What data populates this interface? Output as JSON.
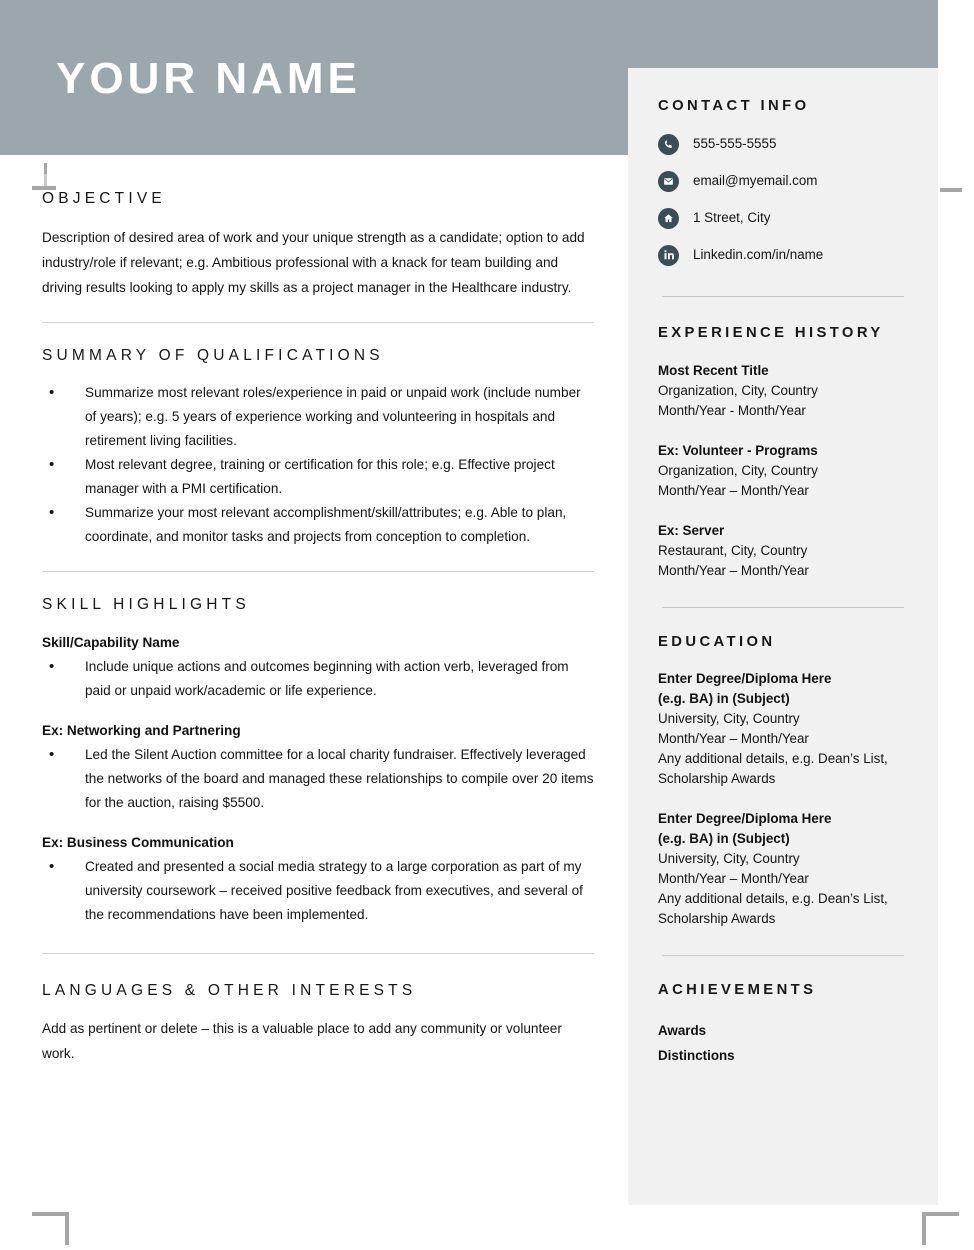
{
  "header": {
    "name": "YOUR NAME",
    "band_color": "#9ca7ad"
  },
  "sidebar": {
    "background": "#f1f1f1",
    "icon_color": "#3b4d57",
    "contact": {
      "title": "CONTACT INFO",
      "items": [
        {
          "icon": "phone-icon",
          "value": "555-555-5555"
        },
        {
          "icon": "envelope-icon",
          "value": "email@myemail.com"
        },
        {
          "icon": "home-icon",
          "value": "1 Street, City"
        },
        {
          "icon": "linkedin-icon",
          "value": "Linkedin.com/in/name"
        }
      ]
    },
    "experience": {
      "title": "EXPERIENCE HISTORY",
      "entries": [
        {
          "title": "Most Recent Title",
          "org": "Organization, City, Country",
          "dates": "Month/Year - Month/Year"
        },
        {
          "title": "Ex: Volunteer - Programs",
          "org": "Organization, City, Country",
          "dates": "Month/Year – Month/Year"
        },
        {
          "title": "Ex: Server",
          "org": "Restaurant, City, Country",
          "dates": "Month/Year – Month/Year"
        }
      ]
    },
    "education": {
      "title": "EDUCATION",
      "entries": [
        {
          "degree_line1": "Enter Degree/Diploma Here",
          "degree_line2": "(e.g. BA) in (Subject)",
          "school": "University, City, Country",
          "dates": "Month/Year – Month/Year",
          "details_line1": "Any additional details, e.g. Dean’s List,",
          "details_line2": "Scholarship Awards"
        },
        {
          "degree_line1": "Enter Degree/Diploma Here",
          "degree_line2": "(e.g. BA) in (Subject)",
          "school": "University, City, Country",
          "dates": "Month/Year – Month/Year",
          "details_line1": "Any additional details, e.g. Dean’s List,",
          "details_line2": "Scholarship Awards"
        }
      ]
    },
    "achievements": {
      "title": "ACHIEVEMENTS",
      "items": [
        "Awards",
        "Distinctions"
      ]
    }
  },
  "main": {
    "objective": {
      "title": "OBJECTIVE",
      "text": "Description of desired area of work and your unique strength as a candidate; option to add industry/role if relevant; e.g. Ambitious professional with a knack for team building and driving results looking to apply my skills as a project manager in the Healthcare industry."
    },
    "summary": {
      "title": "SUMMARY OF QUALIFICATIONS",
      "bullets": [
        "Summarize most relevant roles/experience in paid or unpaid work (include number of years); e.g. 5 years of experience working and volunteering in hospitals and retirement living facilities.",
        "Most relevant degree, training or certification for this role; e.g. Effective project manager with a PMI certification.",
        "Summarize your most relevant accomplishment/skill/attributes; e.g. Able to plan, coordinate, and monitor tasks and projects from conception to completion."
      ]
    },
    "skills": {
      "title": "SKILL HIGHLIGHTS",
      "blocks": [
        {
          "heading": "Skill/Capability Name",
          "bullets": [
            "Include unique actions and outcomes beginning with action verb, leveraged from paid or unpaid work/academic or life experience."
          ]
        },
        {
          "heading": "Ex: Networking and Partnering",
          "bullets": [
            "Led the Silent Auction committee for a local charity fundraiser. Effectively leveraged the networks of the board and managed these relationships to compile over 20 items for the auction, raising $5500."
          ]
        },
        {
          "heading": "Ex: Business Communication",
          "bullets": [
            "Created and presented a social media strategy to a large corporation as part of my university coursework – received positive feedback from executives, and several of the recommendations have been implemented."
          ]
        }
      ]
    },
    "languages": {
      "title": "LANGUAGES & OTHER INTERESTS",
      "text": "Add as pertinent or delete – this is a valuable place to add any community or volunteer work."
    }
  }
}
